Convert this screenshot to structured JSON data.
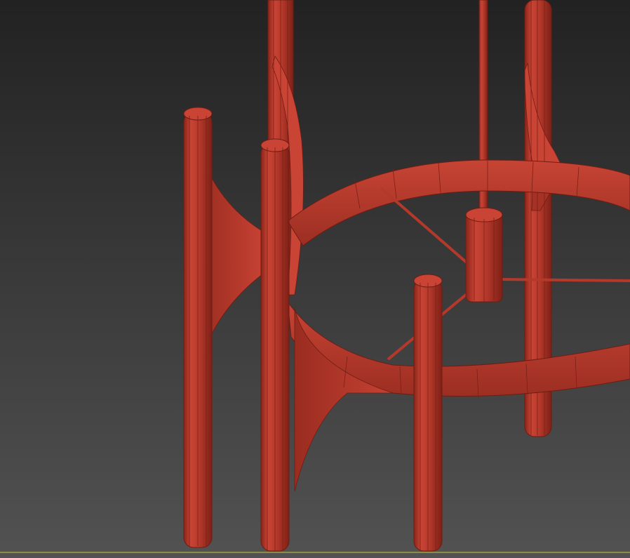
{
  "viewport": {
    "background_top": "#222222",
    "background_bottom": "#525252",
    "grid_line_color": "#8e8a48"
  },
  "model": {
    "object": "chandelier-frame",
    "shading": "edged-faces",
    "base_color": "#b5392b",
    "highlight_color": "#cf4a39",
    "shadow_color": "#862319",
    "edge_color": "#6e1d14"
  }
}
